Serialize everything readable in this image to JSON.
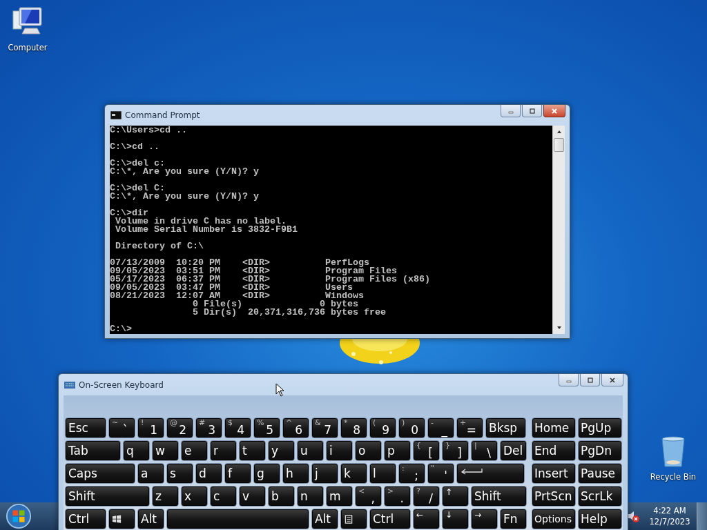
{
  "desktop_icons": [
    {
      "kind": "computer",
      "label": "Computer"
    },
    {
      "kind": "recycle",
      "label": "Recycle Bin"
    }
  ],
  "console_window": {
    "title": "Command Prompt",
    "blocks": [
      [
        "C:\\Users>cd .."
      ],
      [
        "C:\\>cd .."
      ],
      [
        "C:\\>del c:",
        "C:\\*, Are you sure (Y/N)? y"
      ],
      [
        "C:\\>del C:",
        "C:\\*, Are you sure (Y/N)? y"
      ],
      [
        "C:\\>dir",
        " Volume in drive C has no label.",
        " Volume Serial Number is 3832-F9B1"
      ],
      [
        " Directory of C:\\"
      ],
      [
        "07/13/2009  10:20 PM    <DIR>          PerfLogs",
        "09/05/2023  03:51 PM    <DIR>          Program Files",
        "05/17/2023  06:37 PM    <DIR>          Program Files (x86)",
        "09/05/2023  03:47 PM    <DIR>          Users",
        "08/21/2023  12:07 AM    <DIR>          Windows",
        "               0 File(s)              0 bytes",
        "               5 Dir(s)  20,371,316,736 bytes free"
      ],
      [
        "C:\\>"
      ]
    ]
  },
  "keyboard_window": {
    "title": "On-Screen Keyboard",
    "rows": [
      {
        "keys": [
          {
            "kind": "text",
            "label": "Esc"
          },
          {
            "kind": "dual",
            "top": "~",
            "main": "`"
          },
          {
            "kind": "dual",
            "top": "!",
            "main": "1"
          },
          {
            "kind": "dual",
            "top": "@",
            "main": "2"
          },
          {
            "kind": "dual",
            "top": "#",
            "main": "3"
          },
          {
            "kind": "dual",
            "top": "$",
            "main": "4"
          },
          {
            "kind": "dual",
            "top": "%",
            "main": "5"
          },
          {
            "kind": "dual",
            "top": "^",
            "main": "6"
          },
          {
            "kind": "dual",
            "top": "&",
            "main": "7"
          },
          {
            "kind": "dual",
            "top": "*",
            "main": "8"
          },
          {
            "kind": "dual",
            "top": "(",
            "main": "9"
          },
          {
            "kind": "dual",
            "top": ")",
            "main": "0"
          },
          {
            "kind": "dual",
            "top": "-",
            "main": "_"
          },
          {
            "kind": "dual",
            "top": "+",
            "main": "="
          },
          {
            "kind": "text",
            "label": "Bksp"
          }
        ]
      },
      {
        "keys": [
          {
            "kind": "text",
            "label": "Tab"
          },
          {
            "kind": "text",
            "label": "q"
          },
          {
            "kind": "text",
            "label": "w"
          },
          {
            "kind": "text",
            "label": "e"
          },
          {
            "kind": "text",
            "label": "r"
          },
          {
            "kind": "text",
            "label": "t"
          },
          {
            "kind": "text",
            "label": "y"
          },
          {
            "kind": "text",
            "label": "u"
          },
          {
            "kind": "text",
            "label": "i"
          },
          {
            "kind": "text",
            "label": "o"
          },
          {
            "kind": "text",
            "label": "p"
          },
          {
            "kind": "dual",
            "top": "{",
            "main": "["
          },
          {
            "kind": "dual",
            "top": "}",
            "main": "]"
          },
          {
            "kind": "dual",
            "top": "|",
            "main": "\\"
          },
          {
            "kind": "text",
            "label": "Del"
          }
        ]
      },
      {
        "keys": [
          {
            "kind": "text",
            "label": "Caps"
          },
          {
            "kind": "text",
            "label": "a"
          },
          {
            "kind": "text",
            "label": "s"
          },
          {
            "kind": "text",
            "label": "d"
          },
          {
            "kind": "text",
            "label": "f"
          },
          {
            "kind": "text",
            "label": "g"
          },
          {
            "kind": "text",
            "label": "h"
          },
          {
            "kind": "text",
            "label": "j"
          },
          {
            "kind": "text",
            "label": "k"
          },
          {
            "kind": "text",
            "label": "l"
          },
          {
            "kind": "dual",
            "top": ":",
            "main": ";"
          },
          {
            "kind": "dual",
            "top": "\"",
            "main": "'"
          },
          {
            "kind": "enter"
          }
        ]
      },
      {
        "keys": [
          {
            "kind": "text",
            "label": "Shift"
          },
          {
            "kind": "text",
            "label": "z"
          },
          {
            "kind": "text",
            "label": "x"
          },
          {
            "kind": "text",
            "label": "c"
          },
          {
            "kind": "text",
            "label": "v"
          },
          {
            "kind": "text",
            "label": "b"
          },
          {
            "kind": "text",
            "label": "n"
          },
          {
            "kind": "text",
            "label": "m"
          },
          {
            "kind": "dual",
            "top": "<",
            "main": ","
          },
          {
            "kind": "dual",
            "top": ">",
            "main": "."
          },
          {
            "kind": "dual",
            "top": "?",
            "main": "/"
          },
          {
            "kind": "arrow",
            "label": "↑"
          },
          {
            "kind": "text",
            "label": "Shift"
          }
        ]
      },
      {
        "keys": [
          {
            "kind": "text",
            "label": "Ctrl"
          },
          {
            "kind": "windows"
          },
          {
            "kind": "text",
            "label": "Alt"
          },
          {
            "kind": "space"
          },
          {
            "kind": "text",
            "label": "Alt"
          },
          {
            "kind": "menu"
          },
          {
            "kind": "text",
            "label": "Ctrl"
          },
          {
            "kind": "arrow",
            "label": "←"
          },
          {
            "kind": "arrow",
            "label": "↓"
          },
          {
            "kind": "arrow",
            "label": "→"
          },
          {
            "kind": "text",
            "label": "Fn"
          }
        ]
      }
    ],
    "nav_rows": [
      {
        "keys": [
          "Home",
          "PgUp"
        ]
      },
      {
        "keys": [
          "End",
          "PgDn"
        ]
      },
      {
        "keys": [
          "Insert",
          "Pause"
        ]
      },
      {
        "keys": [
          "PrtScn",
          "ScrLk"
        ]
      },
      {
        "keys": [
          "Options",
          "Help"
        ]
      }
    ]
  },
  "taskbar": {
    "volume_muted": true,
    "time": "4:22 AM",
    "date": "12/7/2023"
  }
}
